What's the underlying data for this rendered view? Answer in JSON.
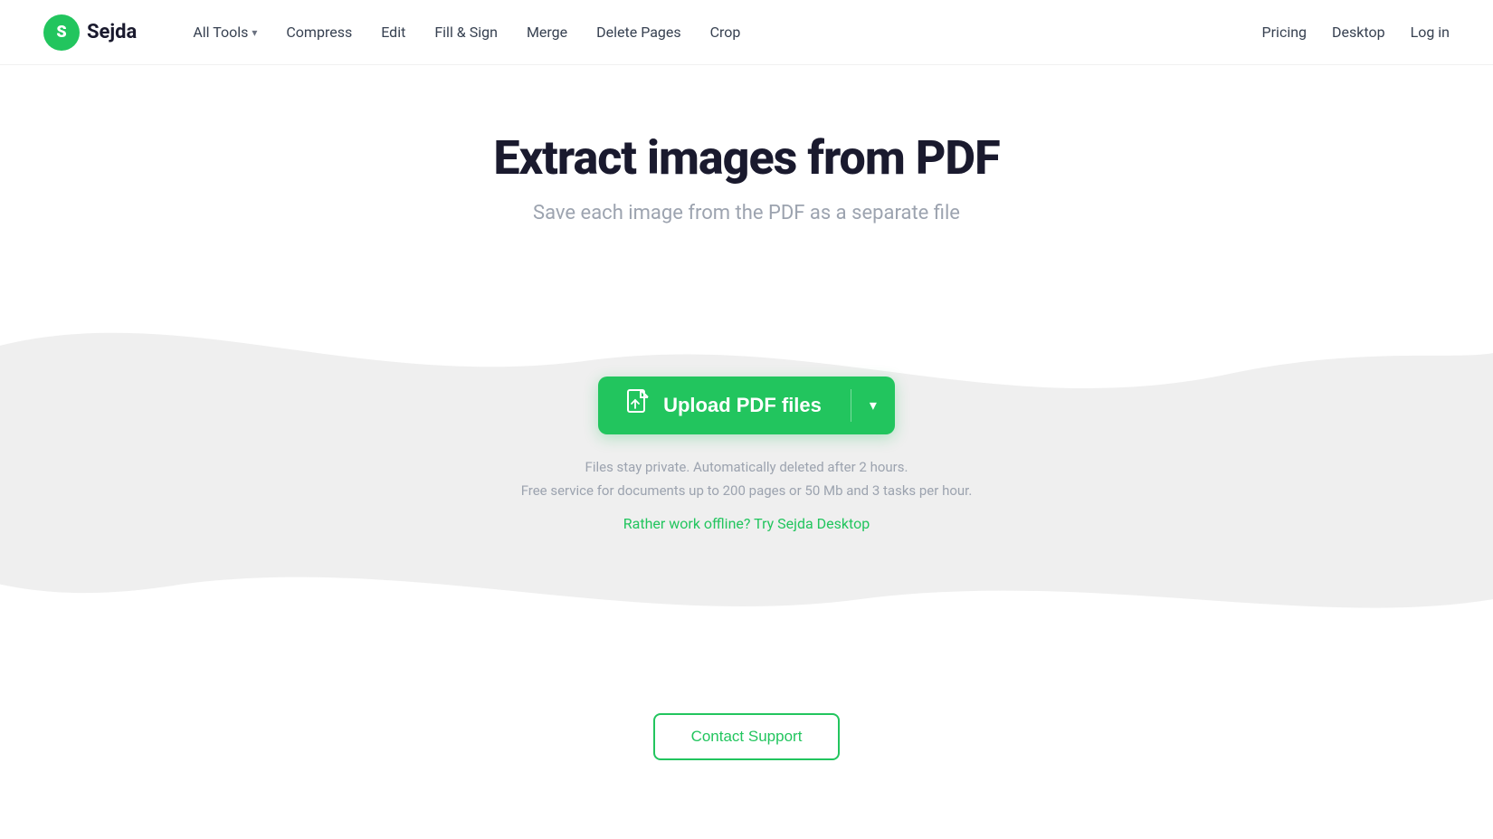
{
  "brand": {
    "logo_letter": "S",
    "name": "Sejda"
  },
  "navbar": {
    "all_tools_label": "All Tools",
    "compress_label": "Compress",
    "edit_label": "Edit",
    "fill_sign_label": "Fill & Sign",
    "merge_label": "Merge",
    "delete_pages_label": "Delete Pages",
    "crop_label": "Crop",
    "pricing_label": "Pricing",
    "desktop_label": "Desktop",
    "login_label": "Log in"
  },
  "hero": {
    "title": "Extract images from PDF",
    "subtitle": "Save each image from the PDF as a separate file"
  },
  "upload": {
    "button_text": "Upload PDF files",
    "privacy_line1": "Files stay private. Automatically deleted after 2 hours.",
    "privacy_line2": "Free service for documents up to 200 pages or 50 Mb and 3 tasks per hour.",
    "offline_link": "Rather work offline? Try Sejda Desktop"
  },
  "footer": {
    "contact_support_label": "Contact Support"
  },
  "colors": {
    "brand_green": "#22c55e",
    "text_dark": "#1a1a2e",
    "text_gray": "#9ca3af",
    "nav_text": "#374151"
  }
}
